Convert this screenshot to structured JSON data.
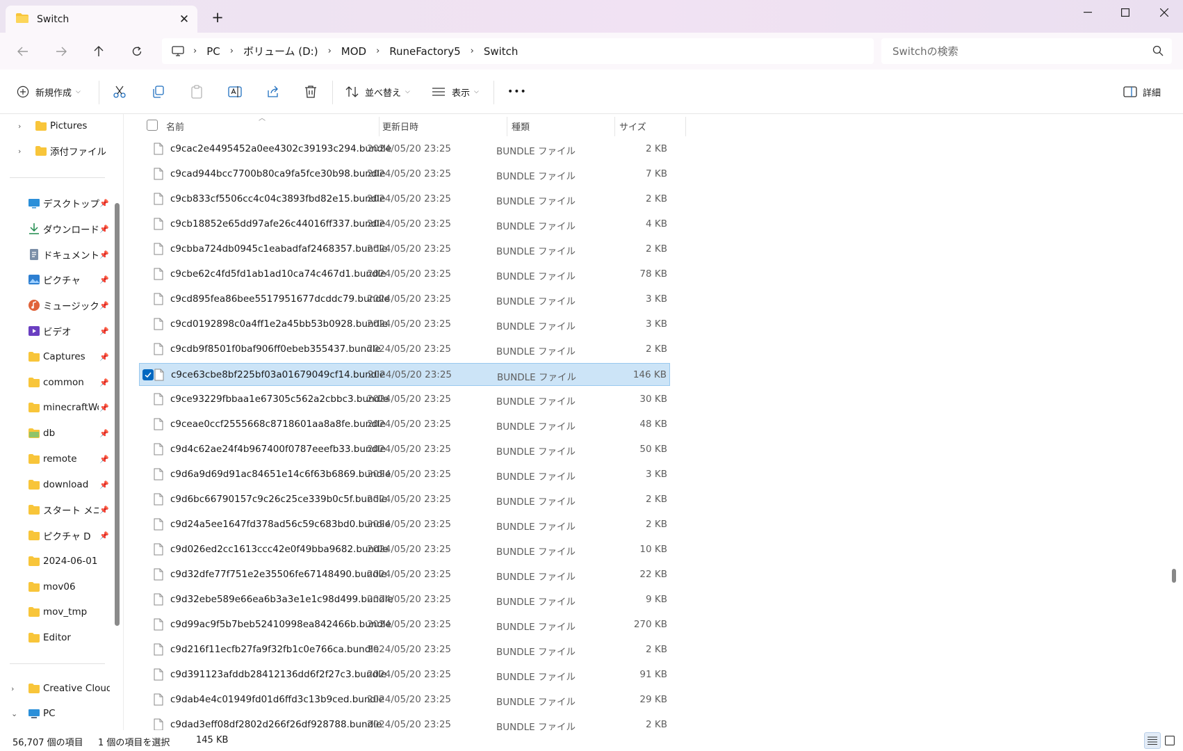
{
  "window": {
    "tab_title": "Switch",
    "new_tab_label": "+"
  },
  "address": {
    "breadcrumbs": [
      "PC",
      "ボリューム (D:)",
      "MOD",
      "RuneFactory5",
      "Switch"
    ],
    "search_placeholder": "Switchの検索"
  },
  "toolbar": {
    "new_label": "新規作成",
    "sort_label": "並べ替え",
    "view_label": "表示",
    "more_label": "•••",
    "details_label": "詳細"
  },
  "sidebar": {
    "tree_top": [
      {
        "label": "Pictures"
      },
      {
        "label": "添付ファイル"
      }
    ],
    "quick_access": [
      {
        "label": "デスクトップ",
        "icon": "desktop-icon"
      },
      {
        "label": "ダウンロード",
        "icon": "download-icon"
      },
      {
        "label": "ドキュメント",
        "icon": "documents-icon"
      },
      {
        "label": "ピクチャ",
        "icon": "pictures-icon"
      },
      {
        "label": "ミュージック",
        "icon": "music-icon"
      },
      {
        "label": "ビデオ",
        "icon": "videos-icon"
      },
      {
        "label": "Captures",
        "icon": "folder-icon"
      },
      {
        "label": "common",
        "icon": "folder-icon"
      },
      {
        "label": "minecraftWor",
        "icon": "folder-icon"
      },
      {
        "label": "db",
        "icon": "folder-icon"
      },
      {
        "label": "remote",
        "icon": "folder-icon"
      },
      {
        "label": "download",
        "icon": "folder-icon"
      },
      {
        "label": "スタート メニュー",
        "icon": "folder-icon"
      },
      {
        "label": "ピクチャ D",
        "icon": "folder-icon"
      },
      {
        "label": "2024-06-01",
        "icon": "folder-icon"
      },
      {
        "label": "mov06",
        "icon": "folder-icon"
      },
      {
        "label": "mov_tmp",
        "icon": "folder-icon"
      },
      {
        "label": "Editor",
        "icon": "folder-icon"
      }
    ],
    "tree_bottom": [
      {
        "label": "Creative Cloud F",
        "expander": ">"
      },
      {
        "label": "PC",
        "expander": "v"
      }
    ]
  },
  "columns": {
    "name": "名前",
    "date": "更新日時",
    "type": "種類",
    "size": "サイズ"
  },
  "files": [
    {
      "name": "c9cac2e4495452a0ee4302c39193c294.bundle",
      "date": "2024/05/20 23:25",
      "type": "BUNDLE ファイル",
      "size": "2 KB"
    },
    {
      "name": "c9cad944bcc7700b80ca9fa5fce30b98.bundle",
      "date": "2024/05/20 23:25",
      "type": "BUNDLE ファイル",
      "size": "7 KB"
    },
    {
      "name": "c9cb833cf5506cc4c04c3893fbd82e15.bundle",
      "date": "2024/05/20 23:25",
      "type": "BUNDLE ファイル",
      "size": "2 KB"
    },
    {
      "name": "c9cb18852e65dd97afe26c44016ff337.bundle",
      "date": "2024/05/20 23:25",
      "type": "BUNDLE ファイル",
      "size": "4 KB"
    },
    {
      "name": "c9cbba724db0945c1eabadfaf2468357.bundle",
      "date": "2024/05/20 23:25",
      "type": "BUNDLE ファイル",
      "size": "2 KB"
    },
    {
      "name": "c9cbe62c4fd5fd1ab1ad10ca74c467d1.bundle",
      "date": "2024/05/20 23:25",
      "type": "BUNDLE ファイル",
      "size": "78 KB"
    },
    {
      "name": "c9cd895fea86bee5517951677dcddc79.bundle",
      "date": "2024/05/20 23:25",
      "type": "BUNDLE ファイル",
      "size": "3 KB"
    },
    {
      "name": "c9cd0192898c0a4ff1e2a45bb53b0928.bundle",
      "date": "2024/05/20 23:25",
      "type": "BUNDLE ファイル",
      "size": "3 KB"
    },
    {
      "name": "c9cdb9f8501f0baf906ff0ebeb355437.bundle",
      "date": "2024/05/20 23:25",
      "type": "BUNDLE ファイル",
      "size": "2 KB"
    },
    {
      "name": "c9ce63cbe8bf225bf03a01679049cf14.bundle",
      "date": "2024/05/20 23:25",
      "type": "BUNDLE ファイル",
      "size": "146 KB",
      "selected": true
    },
    {
      "name": "c9ce93229fbbaa1e67305c562a2cbbc3.bundle",
      "date": "2024/05/20 23:25",
      "type": "BUNDLE ファイル",
      "size": "30 KB"
    },
    {
      "name": "c9ceae0ccf2555668c8718601aa8a8fe.bundle",
      "date": "2024/05/20 23:25",
      "type": "BUNDLE ファイル",
      "size": "48 KB"
    },
    {
      "name": "c9d4c62ae24f4b967400f0787eeefb33.bundle",
      "date": "2024/05/20 23:25",
      "type": "BUNDLE ファイル",
      "size": "50 KB"
    },
    {
      "name": "c9d6a9d69d91ac84651e14c6f63b6869.bundle",
      "date": "2024/05/20 23:25",
      "type": "BUNDLE ファイル",
      "size": "3 KB"
    },
    {
      "name": "c9d6bc66790157c9c26c25ce339b0c5f.bundle",
      "date": "2024/05/20 23:25",
      "type": "BUNDLE ファイル",
      "size": "2 KB"
    },
    {
      "name": "c9d24a5ee1647fd378ad56c59c683bd0.bundle",
      "date": "2024/05/20 23:25",
      "type": "BUNDLE ファイル",
      "size": "2 KB"
    },
    {
      "name": "c9d026ed2cc1613ccc42e0f49bba9682.bundle",
      "date": "2024/05/20 23:25",
      "type": "BUNDLE ファイル",
      "size": "10 KB"
    },
    {
      "name": "c9d32dfe77f751e2e35506fe67148490.bundle",
      "date": "2024/05/20 23:25",
      "type": "BUNDLE ファイル",
      "size": "22 KB"
    },
    {
      "name": "c9d32ebe589e66ea6b3a3e1e1c98d499.bundle",
      "date": "2024/05/20 23:25",
      "type": "BUNDLE ファイル",
      "size": "9 KB"
    },
    {
      "name": "c9d99ac9f5b7beb52410998ea842466b.bundle",
      "date": "2024/05/20 23:25",
      "type": "BUNDLE ファイル",
      "size": "270 KB"
    },
    {
      "name": "c9d216f11ecfb27fa9f32fb1c0e766ca.bundle",
      "date": "2024/05/20 23:25",
      "type": "BUNDLE ファイル",
      "size": "2 KB"
    },
    {
      "name": "c9d391123afddb28412136dd6f2f27c3.bundle",
      "date": "2024/05/20 23:25",
      "type": "BUNDLE ファイル",
      "size": "91 KB"
    },
    {
      "name": "c9dab4e4c01949fd01d6ffd3c13b9ced.bundle",
      "date": "2024/05/20 23:25",
      "type": "BUNDLE ファイル",
      "size": "29 KB"
    },
    {
      "name": "c9dad3eff08df2802d266f26df928788.bundle",
      "date": "2024/05/20 23:25",
      "type": "BUNDLE ファイル",
      "size": "2 KB"
    }
  ],
  "status": {
    "item_count": "56,707 個の項目",
    "selection": "1 個の項目を選択",
    "selection_size": "145 KB"
  },
  "colors": {
    "accent": "#0067c0",
    "selection_bg": "#cce4f7",
    "folder_yellow": "#f8c53a",
    "titlebar": "#f0e4f2"
  }
}
